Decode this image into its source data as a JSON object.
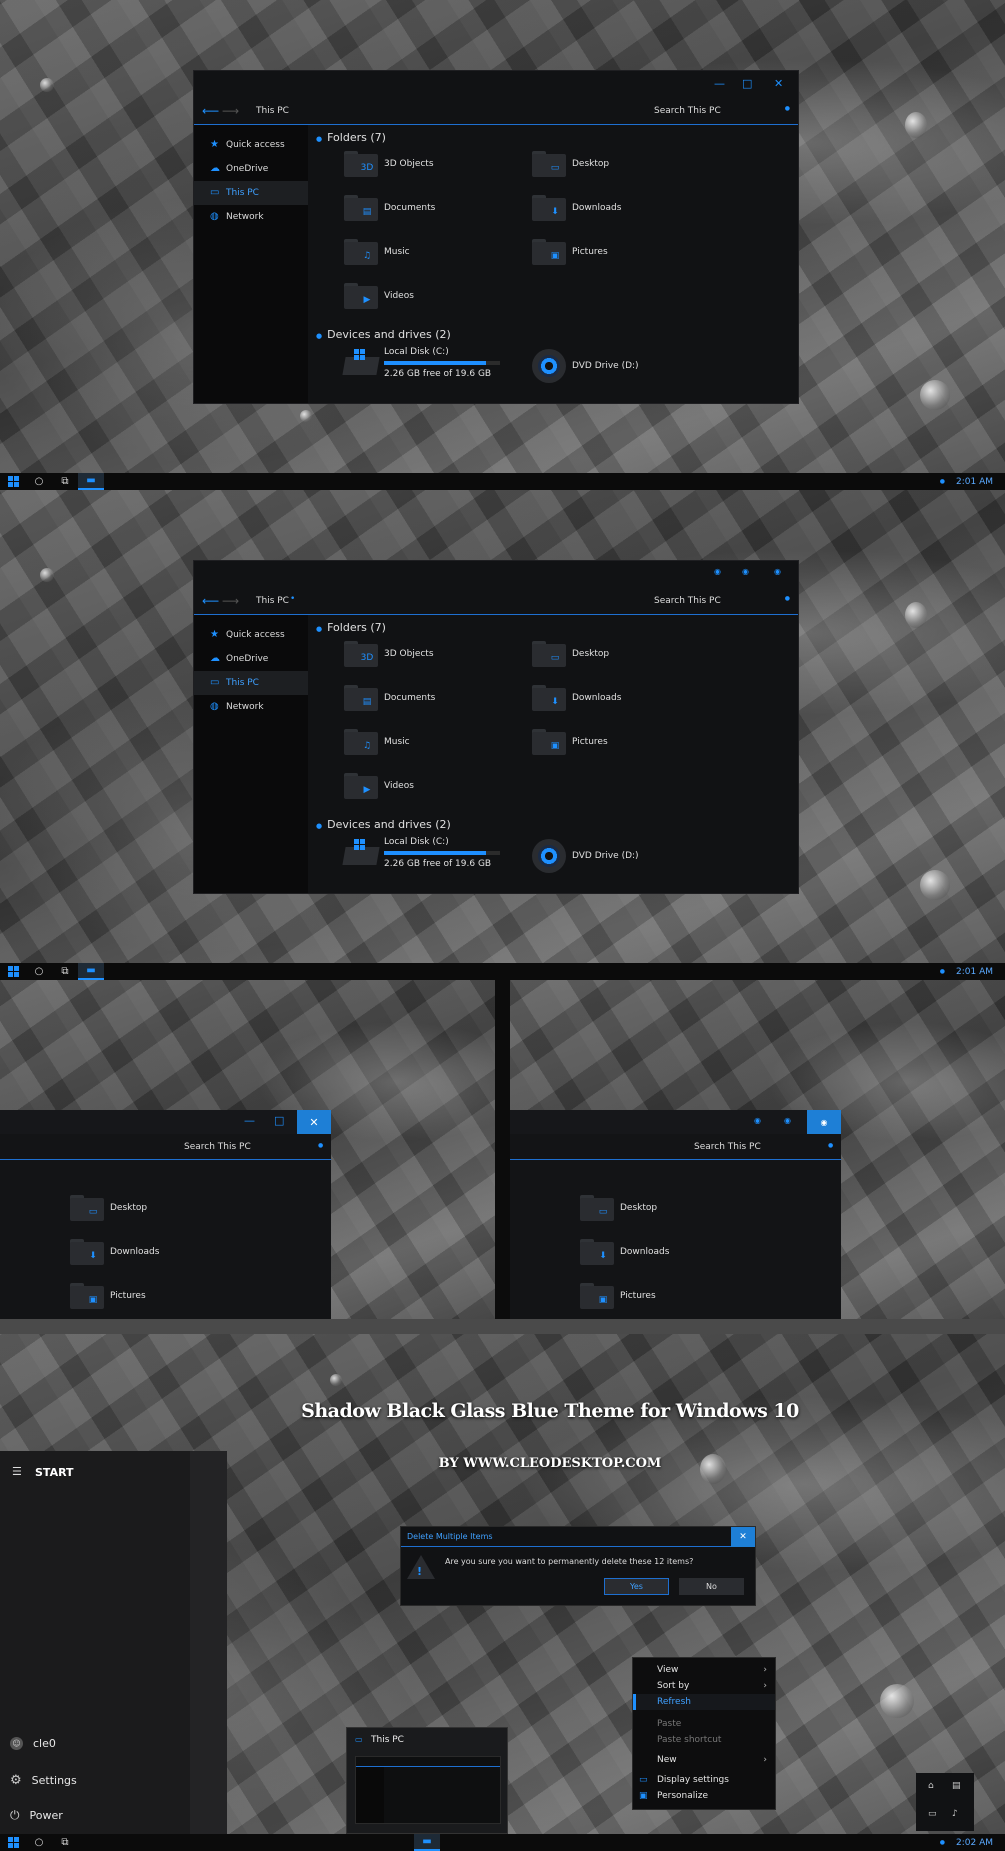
{
  "explorer": {
    "path": "This PC",
    "search": "Search This PC",
    "nav": [
      "Quick access",
      "OneDrive",
      "This PC",
      "Network"
    ],
    "folders_header": "Folders (7)",
    "devices_header": "Devices and drives (2)",
    "folders": [
      "3D Objects",
      "Desktop",
      "Documents",
      "Downloads",
      "Music",
      "Pictures",
      "Videos"
    ],
    "drive_c_name": "Local Disk (C:)",
    "drive_c_free": "2.26 GB free of 19.6 GB",
    "drive_c_used": 0.88,
    "drive_d_name": "DVD Drive (D:)",
    "ctrl_a": {
      "min": "—",
      "max": "□",
      "close": "✕"
    },
    "ctrl_b": {
      "min": "◉",
      "max": "◉",
      "close": "◉"
    }
  },
  "crops": {
    "search": "Search This PC",
    "items": [
      "Desktop",
      "Downloads",
      "Pictures"
    ]
  },
  "clock": {
    "first": "2:01 AM",
    "second": "2:01 AM",
    "third": "2:02 AM"
  },
  "banner": {
    "title": "Shadow Black Glass Blue Theme for Windows 10",
    "by": "BY WWW.CLEODESKTOP.COM"
  },
  "start": {
    "title": "START",
    "user": "cle0",
    "settings": "Settings",
    "power": "Power"
  },
  "dialog": {
    "title": "Delete Multiple Items",
    "message": "Are you sure you want to permanently delete these 12 items?",
    "yes": "Yes",
    "no": "No",
    "close": "✕"
  },
  "context": {
    "items": [
      "View",
      "Sort by",
      "Refresh",
      "Paste",
      "Paste shortcut",
      "New",
      "Display settings",
      "Personalize"
    ]
  },
  "thumb": {
    "title": "This PC"
  },
  "colors": {
    "accent": "#1e90ff",
    "window": "#111214",
    "taskbar": "#0b0b0b"
  }
}
